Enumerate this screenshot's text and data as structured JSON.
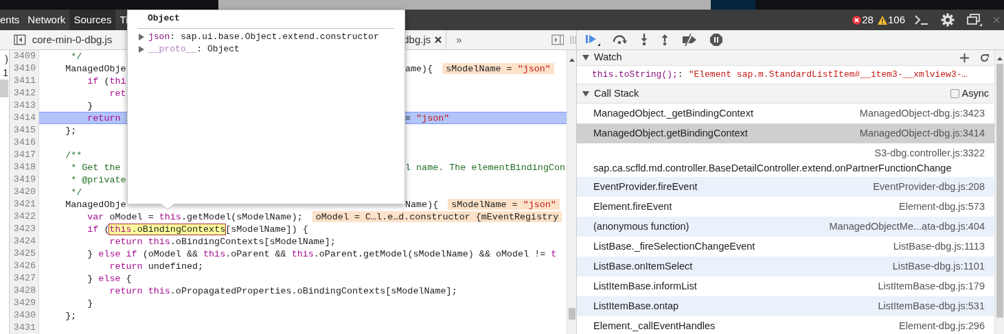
{
  "toolbar": {
    "tabs": [
      {
        "label": "ents",
        "selected": false
      },
      {
        "label": "Network",
        "selected": false
      },
      {
        "label": "Sources",
        "selected": true
      },
      {
        "label": "Ti",
        "selected": false
      }
    ],
    "errors": "28",
    "warnings": "106"
  },
  "editor": {
    "tabs": [
      {
        "label": "core-min-0-dbg.js",
        "closable": false
      },
      {
        "label": "dbg.js",
        "closable": true
      }
    ],
    "more": "»",
    "navigator": [
      {
        "text": ")",
        "selected": false
      },
      {
        "text": "1",
        "selected": false
      },
      {
        "selected": true
      }
    ],
    "lines": [
      {
        "number": "3409",
        "current": false,
        "left": [
          {
            "kind": "comment",
            "text": "     */"
          }
        ]
      },
      {
        "number": "3410",
        "current": false,
        "left": [
          {
            "kind": "plain",
            "text": "    ManagedObje"
          }
        ],
        "right": [
          {
            "kind": "plain",
            "text": "ame){"
          }
        ],
        "annotation": [
          {
            "kind": "plain",
            "text": "sModelName = "
          },
          {
            "kind": "string",
            "text": "\"json\""
          }
        ]
      },
      {
        "number": "3411",
        "current": false,
        "left": [
          {
            "kind": "keyword",
            "text": "        if"
          },
          {
            "kind": "plain",
            "text": " ("
          },
          {
            "kind": "keyword",
            "text": "thi"
          }
        ]
      },
      {
        "number": "3412",
        "current": false,
        "left": [
          {
            "kind": "keyword",
            "text": "            ret"
          }
        ]
      },
      {
        "number": "3413",
        "current": false,
        "left": [
          {
            "kind": "plain",
            "text": "        }"
          }
        ]
      },
      {
        "number": "3414",
        "current": true,
        "left": [
          {
            "kind": "keyword",
            "text": "        return"
          }
        ],
        "right": [
          {
            "kind": "plain",
            "text": "= "
          },
          {
            "kind": "string",
            "text": "\"json\""
          }
        ]
      },
      {
        "number": "3415",
        "current": false,
        "left": [
          {
            "kind": "plain",
            "text": "    };"
          }
        ]
      },
      {
        "number": "3416",
        "current": false
      },
      {
        "number": "3417",
        "current": false,
        "left": [
          {
            "kind": "comment",
            "text": "    /**"
          }
        ]
      },
      {
        "number": "3418",
        "current": false,
        "left": [
          {
            "kind": "comment",
            "text": "     * Get the"
          }
        ],
        "right": [
          {
            "kind": "comment",
            "text": "l name. The elementBindingCon"
          }
        ]
      },
      {
        "number": "3419",
        "current": false,
        "left": [
          {
            "kind": "comment",
            "text": "     * @private"
          }
        ]
      },
      {
        "number": "3420",
        "current": false,
        "left": [
          {
            "kind": "comment",
            "text": "     */"
          }
        ]
      },
      {
        "number": "3421",
        "current": false,
        "left": [
          {
            "kind": "plain",
            "text": "    ManagedObje"
          }
        ],
        "right": [
          {
            "kind": "plain",
            "text": "Name){"
          }
        ],
        "annotation": [
          {
            "kind": "plain",
            "text": "sModelName = "
          },
          {
            "kind": "string",
            "text": "\"json\""
          }
        ]
      },
      {
        "number": "3422",
        "current": false,
        "code": [
          {
            "kind": "keyword",
            "text": "        var"
          },
          {
            "kind": "plain",
            "text": " oModel = "
          },
          {
            "kind": "keyword",
            "text": "this"
          },
          {
            "kind": "plain",
            "text": ".getModel(sModelName);"
          }
        ],
        "annotation": [
          {
            "kind": "plain",
            "text": "oModel = C…l.e…d.constructor {mEventRegistry"
          }
        ]
      },
      {
        "number": "3423",
        "current": false,
        "code": [
          {
            "kind": "keyword",
            "text": "        if"
          },
          {
            "kind": "plain",
            "text": " ("
          },
          {
            "kind": "mark",
            "parts": [
              {
                "kind": "keyword",
                "text": "this"
              },
              {
                "kind": "plain",
                "text": ".oBindingContexts"
              }
            ]
          },
          {
            "kind": "plain",
            "text": "[sModelName]) {"
          }
        ]
      },
      {
        "number": "3424",
        "current": false,
        "code": [
          {
            "kind": "keyword",
            "text": "            return this"
          },
          {
            "kind": "plain",
            "text": ".oBindingContexts[sModelName];"
          }
        ]
      },
      {
        "number": "3425",
        "current": false,
        "code": [
          {
            "kind": "plain",
            "text": "        } "
          },
          {
            "kind": "keyword",
            "text": "else if"
          },
          {
            "kind": "plain",
            "text": " (oModel && "
          },
          {
            "kind": "keyword",
            "text": "this"
          },
          {
            "kind": "plain",
            "text": ".oParent && "
          },
          {
            "kind": "keyword",
            "text": "this"
          },
          {
            "kind": "plain",
            "text": ".oParent.getModel(sModelName) && oModel != "
          },
          {
            "kind": "keyword",
            "text": "t"
          }
        ]
      },
      {
        "number": "3426",
        "current": false,
        "code": [
          {
            "kind": "keyword",
            "text": "            return"
          },
          {
            "kind": "plain",
            "text": " undefined;"
          }
        ]
      },
      {
        "number": "3427",
        "current": false,
        "code": [
          {
            "kind": "plain",
            "text": "        } "
          },
          {
            "kind": "keyword",
            "text": "else"
          },
          {
            "kind": "plain",
            "text": " {"
          }
        ]
      },
      {
        "number": "3428",
        "current": false,
        "code": [
          {
            "kind": "keyword",
            "text": "            return this"
          },
          {
            "kind": "plain",
            "text": ".oPropagatedProperties.oBindingContexts[sModelName];"
          }
        ]
      },
      {
        "number": "3429",
        "current": false,
        "code": [
          {
            "kind": "plain",
            "text": "        }"
          }
        ]
      },
      {
        "number": "3430",
        "current": false,
        "code": [
          {
            "kind": "plain",
            "text": "    };"
          }
        ]
      },
      {
        "number": "3431",
        "current": false
      }
    ]
  },
  "popover": {
    "title": "Object",
    "entries": [
      {
        "key": "json",
        "separator": ":",
        "value": "sap.ui.base.Object.extend.constructor",
        "kind": "own"
      },
      {
        "key": "__proto__",
        "separator": ":",
        "value": "Object",
        "kind": "proto"
      }
    ]
  },
  "watch": {
    "title": "Watch",
    "items": [
      {
        "expression": "this.toString();",
        "separator": ":",
        "value": "\"Element sap.m.StandardListItem#__item3-__xmlview3-…"
      }
    ]
  },
  "call_stack": {
    "title": "Call Stack",
    "async": {
      "label": "Async",
      "checked": false
    },
    "frames": [
      {
        "function": "ManagedObject._getBindingContext",
        "location": "ManagedObject-dbg.js:3423",
        "selected": false,
        "tinted": false
      },
      {
        "function": "ManagedObject.getBindingContext",
        "location": "ManagedObject-dbg.js:3414",
        "selected": true,
        "tinted": false
      },
      {
        "function": "sap.ca.scfld.md.controller.BaseDetailController.extend.onPartnerFunctionChange",
        "location": "S3-dbg.controller.js:3322",
        "selected": false,
        "tinted": false
      },
      {
        "function": "EventProvider.fireEvent",
        "location": "EventProvider-dbg.js:208",
        "selected": false,
        "tinted": true
      },
      {
        "function": "Element.fireEvent",
        "location": "Element-dbg.js:573",
        "selected": false,
        "tinted": false
      },
      {
        "function": "(anonymous function)",
        "location": "ManagedObjectMe...ata-dbg.js:404",
        "selected": false,
        "tinted": true
      },
      {
        "function": "ListBase._fireSelectionChangeEvent",
        "location": "ListBase-dbg.js:1113",
        "selected": false,
        "tinted": false
      },
      {
        "function": "ListBase.onItemSelect",
        "location": "ListBase-dbg.js:1101",
        "selected": false,
        "tinted": true
      },
      {
        "function": "ListItemBase.informList",
        "location": "ListItemBase-dbg.js:179",
        "selected": false,
        "tinted": false
      },
      {
        "function": "ListItemBase.ontap",
        "location": "ListItemBase-dbg.js:531",
        "selected": false,
        "tinted": true
      },
      {
        "function": "Element._callEventHandles",
        "location": "Element-dbg.js:296",
        "selected": false,
        "tinted": false
      }
    ]
  }
}
